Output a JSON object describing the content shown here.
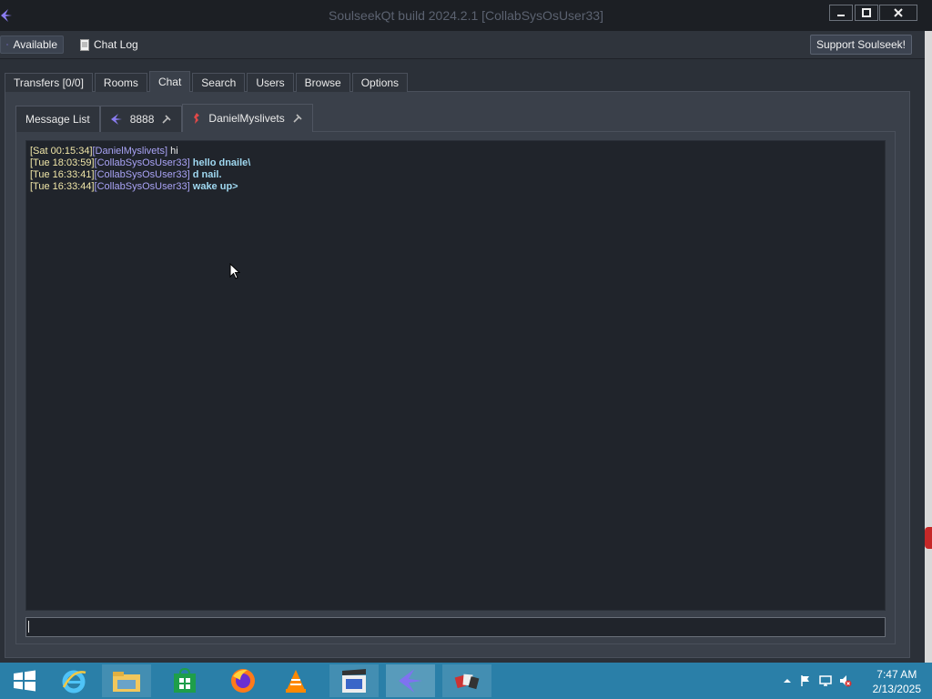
{
  "window": {
    "title": "SoulseekQt build 2024.2.1 [CollabSysOsUser33]",
    "controls": [
      "minimize",
      "maximize",
      "close"
    ]
  },
  "toolbar": {
    "status_label": "Available",
    "chat_log_label": "Chat Log",
    "support_label": "Support Soulseek!"
  },
  "main_tabs": [
    {
      "label": "Transfers [0/0]"
    },
    {
      "label": "Rooms"
    },
    {
      "label": "Chat",
      "active": true
    },
    {
      "label": "Search"
    },
    {
      "label": "Users"
    },
    {
      "label": "Browse"
    },
    {
      "label": "Options"
    }
  ],
  "chat_tabs": [
    {
      "label": "Message List"
    },
    {
      "label": "8888",
      "icon": "soulseek-bird-icon"
    },
    {
      "label": "DanielMyslivets",
      "icon": "user-status-icon",
      "active": true
    }
  ],
  "messages": [
    {
      "time": "[Sat 00:15:34]",
      "user": "[DanielMyslivets]",
      "text": "hi",
      "self": false
    },
    {
      "time": "[Tue 18:03:59]",
      "user": "[CollabSysOsUser33]",
      "text": "hello dnaile\\",
      "self": true
    },
    {
      "time": "[Tue 16:33:41]",
      "user": "[CollabSysOsUser33]",
      "text": "d nail.",
      "self": true
    },
    {
      "time": "[Tue 16:33:44]",
      "user": "[CollabSysOsUser33]",
      "text": "wake up>",
      "self": true
    }
  ],
  "chat_input": {
    "value": ""
  },
  "taskbar": {
    "apps": [
      "windows-start",
      "internet-explorer",
      "file-explorer",
      "store",
      "firefox",
      "vlc",
      "media-player",
      "soulseek",
      "games"
    ],
    "clock_time": "7:47 AM",
    "clock_date": "2/13/2025"
  },
  "colors": {
    "background": "#2b3038",
    "chat_background": "#20242b",
    "timestamp": "#f0e6a8",
    "username": "#a9a3f5",
    "self_message": "#9fd8f0",
    "taskbar": "#2a7fa8"
  }
}
